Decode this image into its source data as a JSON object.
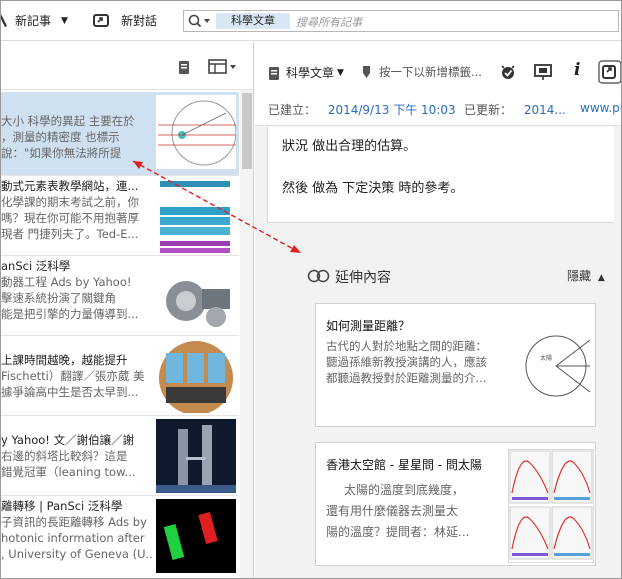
{
  "toolbar": {
    "new_note_label": "新記事",
    "new_chat_label": "新對話",
    "search_scope": "科學文章",
    "search_placeholder": "搜尋所有記事"
  },
  "note_list": {
    "items": [
      {
        "lines": [
          "大小 科學的異起 主要在於",
          "，測量的精密度 也標示",
          "說：\"如果你無法將所提"
        ]
      },
      {
        "lines": [
          "動式元素表教學網站，連...",
          "化學課的期末考試之前，你",
          "嗎？現在你可能不用抱著厚",
          "現者 門捷列夫了。Ted-E..."
        ]
      },
      {
        "lines": [
          "anSci 泛科學",
          "動器工程 Ads by Yahoo!",
          "擊速系統扮演了關鍵角",
          "能是把引擎的力量傳導到..."
        ]
      },
      {
        "lines": [
          "上課時間越晚，越能提升",
          "Fischetti）翻譯／張亦葳 美",
          "據爭論高中生是否太早到..."
        ]
      },
      {
        "lines": [
          "y Yahoo! 文／謝伯讓／謝",
          "右邊的斜塔比較斜？這是",
          "錯覺冠軍（leaning tow..."
        ]
      },
      {
        "lines": [
          "離轉移 | PanSci 泛科學",
          "子資訊的長距離轉移 Ads by",
          "hotonic information after",
          ", University of Geneva (U..."
        ]
      }
    ]
  },
  "editor": {
    "notebook": "科學文章",
    "tag_hint": "按一下以新增標籤...",
    "created_label": "已建立：",
    "created_value": "2014/9/13 下午 10:03",
    "updated_label": "已更新：",
    "updated_value": "2014...",
    "url_value": "www.ph",
    "body_line1": "狀況 做出合理的估算。",
    "body_line2": "然後 做為 下定決策 時的參考。"
  },
  "related": {
    "title": "延伸內容",
    "hide_label": "隱藏",
    "cards": [
      {
        "title": "如何測量距離？",
        "lines": [
          "古代的人對於地點之間的距離：",
          "聽過孫維新教授演講的人，應該",
          "都聽過教授對於距離測量的介..."
        ],
        "img_label": "太陽"
      },
      {
        "title": "香港太空館 - 星星問 - 問太陽",
        "lines": [
          "太陽的溫度到底幾度，",
          "還有用什麼儀器去測量太",
          "陽的溫度？提問者：林延..."
        ]
      }
    ]
  },
  "icons": {
    "accent": "#2a6dbd",
    "arrow_color": "#e02020",
    "selection_bg": "#cfe0f0"
  }
}
